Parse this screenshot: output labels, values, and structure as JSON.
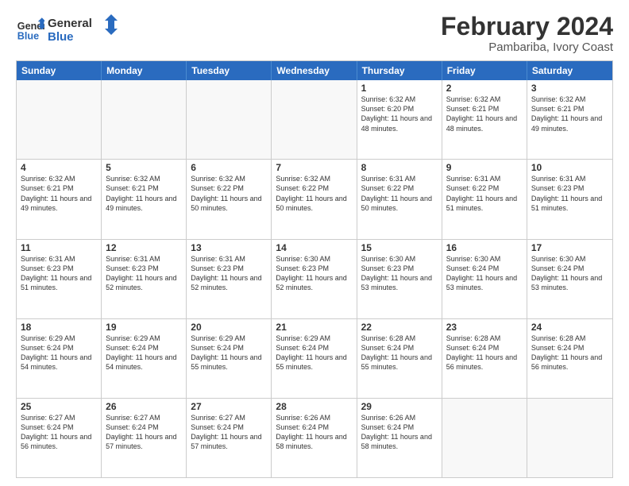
{
  "header": {
    "logo_general": "General",
    "logo_blue": "Blue",
    "main_title": "February 2024",
    "subtitle": "Pambariba, Ivory Coast"
  },
  "calendar": {
    "days_of_week": [
      "Sunday",
      "Monday",
      "Tuesday",
      "Wednesday",
      "Thursday",
      "Friday",
      "Saturday"
    ],
    "rows": [
      [
        {
          "day": "",
          "empty": true
        },
        {
          "day": "",
          "empty": true
        },
        {
          "day": "",
          "empty": true
        },
        {
          "day": "",
          "empty": true
        },
        {
          "day": "1",
          "sunrise": "6:32 AM",
          "sunset": "6:20 PM",
          "daylight": "11 hours and 48 minutes."
        },
        {
          "day": "2",
          "sunrise": "6:32 AM",
          "sunset": "6:21 PM",
          "daylight": "11 hours and 48 minutes."
        },
        {
          "day": "3",
          "sunrise": "6:32 AM",
          "sunset": "6:21 PM",
          "daylight": "11 hours and 49 minutes."
        }
      ],
      [
        {
          "day": "4",
          "sunrise": "6:32 AM",
          "sunset": "6:21 PM",
          "daylight": "11 hours and 49 minutes."
        },
        {
          "day": "5",
          "sunrise": "6:32 AM",
          "sunset": "6:21 PM",
          "daylight": "11 hours and 49 minutes."
        },
        {
          "day": "6",
          "sunrise": "6:32 AM",
          "sunset": "6:22 PM",
          "daylight": "11 hours and 50 minutes."
        },
        {
          "day": "7",
          "sunrise": "6:32 AM",
          "sunset": "6:22 PM",
          "daylight": "11 hours and 50 minutes."
        },
        {
          "day": "8",
          "sunrise": "6:31 AM",
          "sunset": "6:22 PM",
          "daylight": "11 hours and 50 minutes."
        },
        {
          "day": "9",
          "sunrise": "6:31 AM",
          "sunset": "6:22 PM",
          "daylight": "11 hours and 51 minutes."
        },
        {
          "day": "10",
          "sunrise": "6:31 AM",
          "sunset": "6:23 PM",
          "daylight": "11 hours and 51 minutes."
        }
      ],
      [
        {
          "day": "11",
          "sunrise": "6:31 AM",
          "sunset": "6:23 PM",
          "daylight": "11 hours and 51 minutes."
        },
        {
          "day": "12",
          "sunrise": "6:31 AM",
          "sunset": "6:23 PM",
          "daylight": "11 hours and 52 minutes."
        },
        {
          "day": "13",
          "sunrise": "6:31 AM",
          "sunset": "6:23 PM",
          "daylight": "11 hours and 52 minutes."
        },
        {
          "day": "14",
          "sunrise": "6:30 AM",
          "sunset": "6:23 PM",
          "daylight": "11 hours and 52 minutes."
        },
        {
          "day": "15",
          "sunrise": "6:30 AM",
          "sunset": "6:23 PM",
          "daylight": "11 hours and 53 minutes."
        },
        {
          "day": "16",
          "sunrise": "6:30 AM",
          "sunset": "6:24 PM",
          "daylight": "11 hours and 53 minutes."
        },
        {
          "day": "17",
          "sunrise": "6:30 AM",
          "sunset": "6:24 PM",
          "daylight": "11 hours and 53 minutes."
        }
      ],
      [
        {
          "day": "18",
          "sunrise": "6:29 AM",
          "sunset": "6:24 PM",
          "daylight": "11 hours and 54 minutes."
        },
        {
          "day": "19",
          "sunrise": "6:29 AM",
          "sunset": "6:24 PM",
          "daylight": "11 hours and 54 minutes."
        },
        {
          "day": "20",
          "sunrise": "6:29 AM",
          "sunset": "6:24 PM",
          "daylight": "11 hours and 55 minutes."
        },
        {
          "day": "21",
          "sunrise": "6:29 AM",
          "sunset": "6:24 PM",
          "daylight": "11 hours and 55 minutes."
        },
        {
          "day": "22",
          "sunrise": "6:28 AM",
          "sunset": "6:24 PM",
          "daylight": "11 hours and 55 minutes."
        },
        {
          "day": "23",
          "sunrise": "6:28 AM",
          "sunset": "6:24 PM",
          "daylight": "11 hours and 56 minutes."
        },
        {
          "day": "24",
          "sunrise": "6:28 AM",
          "sunset": "6:24 PM",
          "daylight": "11 hours and 56 minutes."
        }
      ],
      [
        {
          "day": "25",
          "sunrise": "6:27 AM",
          "sunset": "6:24 PM",
          "daylight": "11 hours and 56 minutes."
        },
        {
          "day": "26",
          "sunrise": "6:27 AM",
          "sunset": "6:24 PM",
          "daylight": "11 hours and 57 minutes."
        },
        {
          "day": "27",
          "sunrise": "6:27 AM",
          "sunset": "6:24 PM",
          "daylight": "11 hours and 57 minutes."
        },
        {
          "day": "28",
          "sunrise": "6:26 AM",
          "sunset": "6:24 PM",
          "daylight": "11 hours and 58 minutes."
        },
        {
          "day": "29",
          "sunrise": "6:26 AM",
          "sunset": "6:24 PM",
          "daylight": "11 hours and 58 minutes."
        },
        {
          "day": "",
          "empty": true
        },
        {
          "day": "",
          "empty": true
        }
      ]
    ]
  }
}
